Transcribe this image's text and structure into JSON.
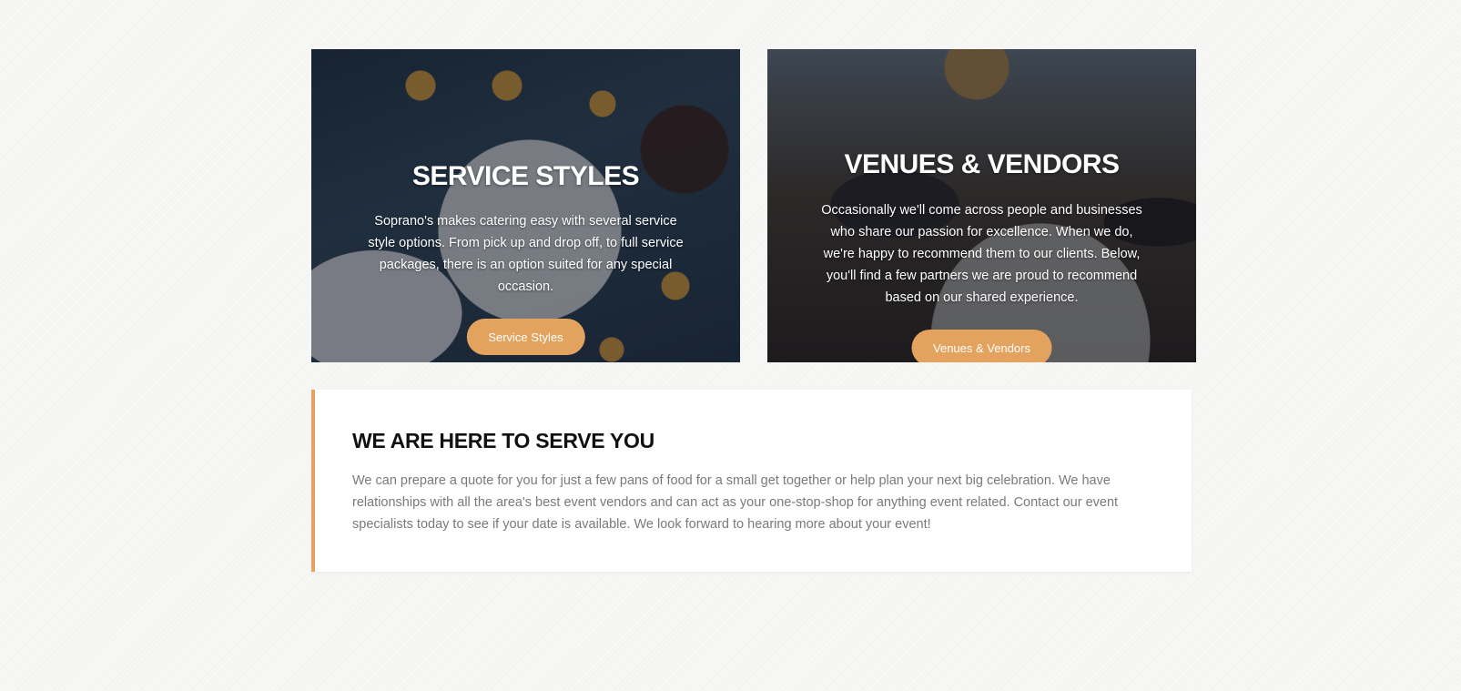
{
  "cards": {
    "service": {
      "title": "SERVICE STYLES",
      "text": "Soprano's makes catering easy with several service style options. From pick up and drop off, to full service packages, there is an option suited for any special occasion.",
      "button": "Service Styles"
    },
    "venues": {
      "title": "VENUES & VENDORS",
      "text": "Occasionally we'll come across people and businesses who share our passion for excellence. When we do, we're happy to recommend them to our clients. Below, you'll find a few partners we are proud to recommend based on our shared experience.",
      "button": "Venues & Vendors"
    }
  },
  "serve": {
    "title": "WE ARE HERE TO SERVE YOU",
    "text": "We can prepare a quote for you for just a few pans of food for a small get together or help plan your next big celebration. We have relationships with all the area's best event vendors and can act as your one-stop-shop for anything event related. Contact our event specialists today to see if your date is available. We look forward to hearing more about your event!"
  },
  "colors": {
    "accent": "#e3a35e",
    "heading": "#111111",
    "body_text": "#7a7a7a",
    "page_background": "#f7f7f6"
  }
}
